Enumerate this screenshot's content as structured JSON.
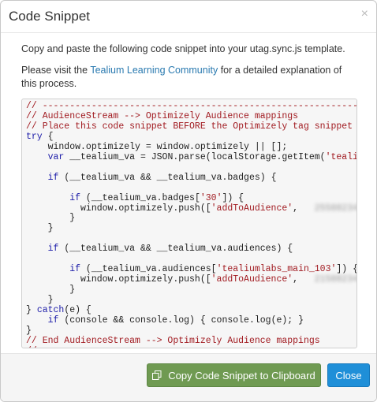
{
  "dialog": {
    "title": "Code Snippet",
    "close_glyph": "×"
  },
  "body": {
    "instruction": "Copy and paste the following code snippet into your utag.sync.js template.",
    "visit_prefix": "Please visit the ",
    "visit_link": "Tealium Learning Community",
    "visit_suffix": " for a detailed explanation of this process."
  },
  "code": {
    "lines": [
      [
        {
          "t": "// --------------------------------------------------------------------------",
          "c": "cm"
        }
      ],
      [
        {
          "t": "// AudienceStream --> Optimizely Audience mappings",
          "c": "cm"
        }
      ],
      [
        {
          "t": "// Place this code snippet BEFORE the Optimizely tag snippet",
          "c": "cm"
        }
      ],
      [
        {
          "t": "try",
          "c": "kw"
        },
        {
          "t": " {"
        }
      ],
      [
        {
          "t": "    window.optimizely = window.optimizely || [];"
        }
      ],
      [
        {
          "t": "    "
        },
        {
          "t": "var",
          "c": "kw"
        },
        {
          "t": " __tealium_va = JSON.parse(localStorage.getItem("
        },
        {
          "t": "'tealium_va'",
          "c": "st"
        },
        {
          "t": "));"
        }
      ],
      [
        {
          "t": ""
        }
      ],
      [
        {
          "t": "    "
        },
        {
          "t": "if",
          "c": "kw"
        },
        {
          "t": " (__tealium_va && __tealium_va.badges) {"
        }
      ],
      [
        {
          "t": ""
        }
      ],
      [
        {
          "t": "        "
        },
        {
          "t": "if",
          "c": "kw"
        },
        {
          "t": " (__tealium_va.badges["
        },
        {
          "t": "'30'",
          "c": "st"
        },
        {
          "t": "]) {"
        }
      ],
      [
        {
          "t": "          window.optimizely.push(["
        },
        {
          "t": "'addToAudience'",
          "c": "st"
        },
        {
          "t": ",   "
        },
        {
          "t": "2558823482",
          "c": "bl"
        }
      ],
      [
        {
          "t": "        }"
        }
      ],
      [
        {
          "t": "    }"
        }
      ],
      [
        {
          "t": ""
        }
      ],
      [
        {
          "t": "    "
        },
        {
          "t": "if",
          "c": "kw"
        },
        {
          "t": " (__tealium_va && __tealium_va.audiences) {"
        }
      ],
      [
        {
          "t": ""
        }
      ],
      [
        {
          "t": "        "
        },
        {
          "t": "if",
          "c": "kw"
        },
        {
          "t": " (__tealium_va.audiences["
        },
        {
          "t": "'tealiumlabs_main_103'",
          "c": "st"
        },
        {
          "t": "]) {"
        }
      ],
      [
        {
          "t": "          window.optimizely.push(["
        },
        {
          "t": "'addToAudience'",
          "c": "st"
        },
        {
          "t": ",   "
        },
        {
          "t": "2158823482",
          "c": "bl"
        }
      ],
      [
        {
          "t": "        }"
        }
      ],
      [
        {
          "t": "    }"
        }
      ],
      [
        {
          "t": "} "
        },
        {
          "t": "catch",
          "c": "kw"
        },
        {
          "t": "(e) {"
        }
      ],
      [
        {
          "t": "    "
        },
        {
          "t": "if",
          "c": "kw"
        },
        {
          "t": " (console && console.log) { console.log(e); }"
        }
      ],
      [
        {
          "t": "}"
        }
      ],
      [
        {
          "t": "// End AudienceStream --> Optimizely Audience mappings",
          "c": "cm"
        }
      ],
      [
        {
          "t": "// --------------------------------------------------------------------------",
          "c": "cm"
        }
      ]
    ]
  },
  "footer": {
    "copy_label": "Copy Code Snippet to Clipboard",
    "close_label": "Close"
  },
  "icons": {
    "copy": "copy-icon",
    "close": "close-icon"
  },
  "colors": {
    "copy_button": "#6f9a52",
    "close_button": "#1f8fd8",
    "link": "#2a7ab0",
    "comment": "#a11a20",
    "keyword": "#1c1ca8"
  }
}
